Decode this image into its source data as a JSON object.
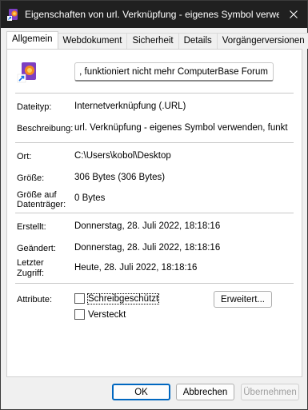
{
  "window": {
    "title": "Eigenschaften von url. Verknüpfung - eigenes Symbol verwen..."
  },
  "tabs": [
    {
      "label": "Allgemein",
      "active": true
    },
    {
      "label": "Webdokument"
    },
    {
      "label": "Sicherheit"
    },
    {
      "label": "Details"
    },
    {
      "label": "Vorgängerversionen"
    }
  ],
  "general": {
    "name_value": "url. Verknüpfung - eigenes Symbol verwenden, funktioniert nicht mehr ComputerBase Forum",
    "filetype_label": "Dateityp:",
    "filetype_value": "Internetverknüpfung (.URL)",
    "description_label": "Beschreibung:",
    "description_value": "url. Verknüpfung - eigenes Symbol verwenden, funkt",
    "location_label": "Ort:",
    "location_value": "C:\\Users\\kobol\\Desktop",
    "size_label": "Größe:",
    "size_value": "306 Bytes (306 Bytes)",
    "size_on_disk_label_1": "Größe auf",
    "size_on_disk_label_2": "Datenträger:",
    "size_on_disk_value": "0 Bytes",
    "created_label": "Erstellt:",
    "created_value": "Donnerstag, 28. Juli 2022, 18:18:16",
    "modified_label": "Geändert:",
    "modified_value": "Donnerstag, 28. Juli 2022, 18:18:16",
    "accessed_label_1": "Letzter",
    "accessed_label_2": "Zugriff:",
    "accessed_value": "Heute, 28. Juli 2022, 18:18:16",
    "attributes_label": "Attribute:",
    "readonly_label": "Schreibgeschützt",
    "hidden_label": "Versteckt",
    "advanced_label": "Erweitert..."
  },
  "footer": {
    "ok": "OK",
    "cancel": "Abbrechen",
    "apply": "Übernehmen"
  },
  "colors": {
    "titlebar": "#202020",
    "accent": "#0067c0"
  },
  "icons": {
    "app": "url-shortcut-icon",
    "close": "close-icon",
    "file": "url-shortcut-icon"
  }
}
